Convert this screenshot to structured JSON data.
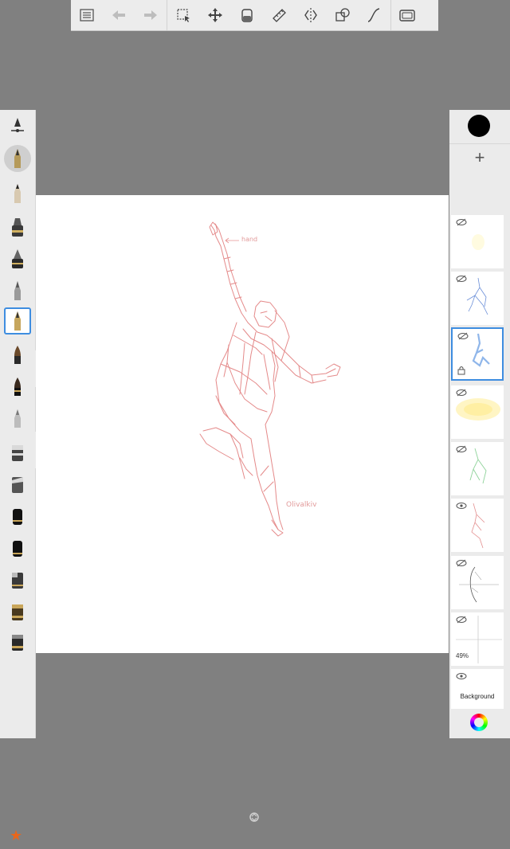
{
  "toolbar": {
    "items": [
      {
        "name": "layer-list",
        "icon": "list-icon"
      },
      {
        "name": "undo",
        "icon": "undo-arrow-icon"
      },
      {
        "name": "redo",
        "icon": "redo-arrow-icon"
      },
      {
        "name": "selection",
        "icon": "marquee-select-icon"
      },
      {
        "name": "transform",
        "icon": "move-arrows-icon"
      },
      {
        "name": "fill",
        "icon": "paint-bucket-icon"
      },
      {
        "name": "ruler",
        "icon": "ruler-icon"
      },
      {
        "name": "symmetry",
        "icon": "symmetry-icon"
      },
      {
        "name": "shapes",
        "icon": "shapes-icon"
      },
      {
        "name": "stroke",
        "icon": "curve-stroke-icon"
      },
      {
        "name": "fullscreen",
        "icon": "fullscreen-frame-icon"
      }
    ]
  },
  "brushes": {
    "selected_index": 6,
    "items": [
      "brush-settings",
      "round-preview",
      "pencil",
      "marker",
      "airbrush",
      "felt-pen",
      "ink-pen",
      "paint-brush",
      "chisel-brush",
      "soft-pencil",
      "eraser-block",
      "blender",
      "flat-marker-1",
      "flat-marker-2",
      "brush-block-1",
      "brush-block-2",
      "brush-block-3"
    ]
  },
  "canvas": {
    "sketch_color": "#e07676",
    "annotation_hand": "hand",
    "signature": "Olivalkiv"
  },
  "right_panel": {
    "current_color": "#000000",
    "add_layer_symbol": "+"
  },
  "layers": [
    {
      "visible": false,
      "thumb": "yellow-faint",
      "opacity": ""
    },
    {
      "visible": false,
      "thumb": "blue-sketch",
      "opacity": ""
    },
    {
      "visible": false,
      "thumb": "blue-figure",
      "opacity": "",
      "selected": true,
      "locked": true
    },
    {
      "visible": false,
      "thumb": "yellow-glow",
      "opacity": ""
    },
    {
      "visible": false,
      "thumb": "green-sketch",
      "opacity": ""
    },
    {
      "visible": true,
      "thumb": "red-figure",
      "opacity": ""
    },
    {
      "visible": false,
      "thumb": "guides",
      "opacity": ""
    },
    {
      "visible": false,
      "thumb": "crosshair",
      "opacity": "49%"
    },
    {
      "visible": true,
      "thumb": "background",
      "label": "Background"
    }
  ],
  "favorites_icon": "★"
}
